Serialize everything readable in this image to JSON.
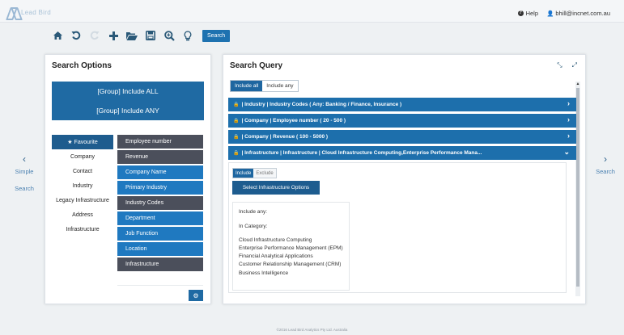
{
  "app": {
    "logo_text": "Lead Bird"
  },
  "topbar": {
    "help_label": "Help",
    "user_email": "bhill@incnet.com.au"
  },
  "toolbar": {
    "search_label": "Search",
    "icons": [
      "home-icon",
      "undo-icon",
      "redo-icon",
      "plus-icon",
      "folder-open-icon",
      "save-icon",
      "zoom-icon",
      "lightbulb-icon"
    ]
  },
  "nav": {
    "left_line1": "Simple",
    "left_line2": "Search",
    "right_label": "Search"
  },
  "search_options": {
    "title": "Search Options",
    "group_all": "[Group]  Include ALL",
    "group_any": "[Group]  Include ANY",
    "categories": [
      "Favourite",
      "Company",
      "Contact",
      "Industry",
      "Legacy Infrastructure",
      "Address",
      "Infrastructure"
    ],
    "fields": [
      {
        "label": "Employee number",
        "style": "dark"
      },
      {
        "label": "Revenue",
        "style": "dark"
      },
      {
        "label": "Company Name",
        "style": "blue"
      },
      {
        "label": "Primary Industry",
        "style": "blue"
      },
      {
        "label": "Industry Codes",
        "style": "dark"
      },
      {
        "label": "Department",
        "style": "blue"
      },
      {
        "label": "Job Function",
        "style": "blue"
      },
      {
        "label": "Location",
        "style": "blue"
      },
      {
        "label": "Infrastructure",
        "style": "dark"
      }
    ]
  },
  "search_query": {
    "title": "Search Query",
    "toggle_all": "Include all",
    "toggle_any": "Include any",
    "rows": [
      "| Industry | Industry Codes ( Any: Banking / Finance, Insurance )",
      "| Company | Employee number ( 20 - 500 )",
      "| Company | Revenue ( 100 - 5000 )",
      "| Infrastructure | Infrastructure | Cloud Infrastructure Computing,Enterprise Performance Mana..."
    ],
    "include_label": "Include",
    "exclude_label": "Exclude",
    "select_button": "Select Infrastructure Options",
    "summary_include": "Include any:",
    "summary_category": "In Category:",
    "summary_items": [
      "Cloud Infrastructure Computing",
      "Enterprise Performance Management (EPM)",
      "Financial Analytical Applications",
      "Customer Relationship Management (CRM)",
      "Business Intelligence"
    ]
  },
  "footer": {
    "text": "©2016 Lead Bird Analytics Pty Ltd. Australia"
  },
  "colors": {
    "primary_blue": "#1f6aa3",
    "dark_field": "#4b4f5b",
    "bright_field": "#1f79c0"
  }
}
